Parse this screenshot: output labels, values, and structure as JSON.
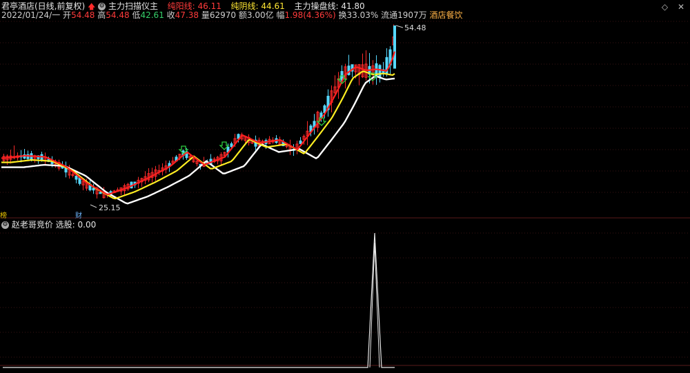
{
  "header": {
    "stock_title": "君亭酒店(日线,前复权)",
    "indicator_name": "主力扫描仪主",
    "pure_yang_label": "纯阳线:",
    "pure_yang_value": "46.11",
    "pure_yin_label": "纯阴线:",
    "pure_yin_value": "44.61",
    "main_line_label": "主力操盘线:",
    "main_line_value": "41.80"
  },
  "quote": {
    "date": "2022/01/24/一",
    "open_label": "开",
    "open": "54.48",
    "high_label": "高",
    "high": "54.48",
    "low_label": "低",
    "low": "42.61",
    "close_label": "收",
    "close": "47.38",
    "volume_label": "量",
    "volume": "62970",
    "amount_label": "额",
    "amount": "3.00亿",
    "change_label": "幅",
    "change": "1.98(4.36%)",
    "turnover_label": "换",
    "turnover": "33.03%",
    "float_label": "流通",
    "float": "1907万",
    "sector": "酒店餐饮"
  },
  "annotations": {
    "max_price": "54.48",
    "min_price": "25.15",
    "left_badge": "榜",
    "fin_badge": "财"
  },
  "sub_panel": {
    "name": "赵老哥竞价",
    "select_label": "选股:",
    "select_value": "0.00"
  },
  "colors": {
    "up": "#ff2a2a",
    "down": "#56d8ff",
    "ma_red": "#ff2020",
    "ma_yellow": "#ffee22",
    "ma_white": "#ffffff",
    "signal_arrow": "#2ecc40"
  },
  "chart_data": {
    "type": "candlestick",
    "price_max": 54.48,
    "price_min": 25.15,
    "signal_arrow_count": 5,
    "sub_indicator_peak": 1.0
  }
}
